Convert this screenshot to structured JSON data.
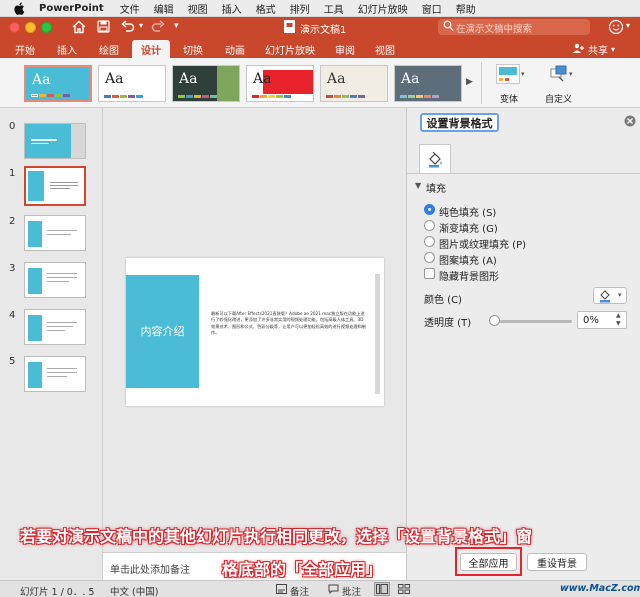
{
  "menubar": {
    "app": "PowerPoint",
    "items": [
      "文件",
      "编辑",
      "视图",
      "插入",
      "格式",
      "排列",
      "工具",
      "幻灯片放映",
      "窗口",
      "帮助"
    ]
  },
  "titlebar": {
    "document_title": "演示文稿1",
    "search_placeholder": "在演示文稿中搜索"
  },
  "ribbon_tabs": [
    "开始",
    "插入",
    "绘图",
    "设计",
    "切换",
    "动画",
    "幻灯片放映",
    "审阅",
    "视图"
  ],
  "active_tab": "设计",
  "share_label": "共享",
  "themes": [
    {
      "label": "Aa",
      "bg": "#4bbcd6",
      "fg": "#ffffff",
      "bars": [
        "#4bbcd6",
        "#f3b23a",
        "#e2574c",
        "#8cc63f",
        "#7a5ba8"
      ]
    },
    {
      "label": "Aa",
      "bg": "#ffffff",
      "fg": "#222222",
      "bars": [
        "#3f7fc7",
        "#e05b3a",
        "#9ab93d",
        "#8e59a7",
        "#2eaad8"
      ]
    },
    {
      "label": "Aa",
      "bg": "#2f3f3a",
      "fg": "#ffffff",
      "bars": [
        "#8cc63f",
        "#3fa2c6",
        "#e2b53a",
        "#c85a7e",
        "#6fbf9c"
      ]
    },
    {
      "label": "Aa",
      "bg": "#e8232c",
      "fg": "#ffffff",
      "bars": [
        "#e8232c",
        "#f3a53a",
        "#f4d33f",
        "#9fc63f",
        "#3f8ec6"
      ]
    },
    {
      "label": "Aa",
      "bg": "#f2ede4",
      "fg": "#333333",
      "bars": [
        "#c0504d",
        "#e28a3a",
        "#9bbb59",
        "#4f81bd",
        "#8064a2"
      ]
    },
    {
      "label": "Aa",
      "bg": "#5d6d7a",
      "fg": "#ffffff",
      "bars": [
        "#7cc3d8",
        "#9bd29a",
        "#f2c96b",
        "#e3877a",
        "#b39ed5"
      ]
    }
  ],
  "variants_label": "变体",
  "customize_label": "自定义",
  "slides": [
    {
      "num": "0"
    },
    {
      "num": "1"
    },
    {
      "num": "2"
    },
    {
      "num": "3"
    },
    {
      "num": "4"
    },
    {
      "num": "5"
    }
  ],
  "slide": {
    "title": "内容介绍",
    "body": "最新可以下载After Effects2021直装版？Adobe ae 2021 mac独立版在功能上进行了较强化改进，更添加了许多非常实用的视频处理功能，包括高级人体工具、3D效果技术、图形和公式、色彩分级等，让用户可以更加轻松高效的进行视频处理和制作。"
  },
  "notes_placeholder": "单击此处添加备注",
  "format_pane": {
    "title": "设置背景格式",
    "section": "填充",
    "options": [
      {
        "label": "纯色填充 (S)",
        "selected": true
      },
      {
        "label": "渐变填充 (G)",
        "selected": false
      },
      {
        "label": "图片或纹理填充 (P)",
        "selected": false
      },
      {
        "label": "图案填充 (A)",
        "selected": false
      }
    ],
    "hide_graphics": "隐藏背景图形",
    "color_label": "颜色 (C)",
    "transparency_label": "透明度 (T)",
    "transparency_value": "0%",
    "apply_all": "全部应用",
    "reset": "重设背景"
  },
  "statusbar": {
    "slide_info": "幻灯片 1 / 0．. 5",
    "language": "中文 (中国)",
    "notes": "备注",
    "comments": "批注",
    "watermark": "www.MacZ.com"
  },
  "annotation": {
    "line1": "若要对演示文稿中的其他幻灯片执行相同更改，选择「设置背景格式」窗",
    "line2": "格底部的「全部应用」"
  },
  "colors": {
    "accent": "#c9472a",
    "slide_blue": "#4bbcd6",
    "highlight_red": "#e3262c"
  }
}
